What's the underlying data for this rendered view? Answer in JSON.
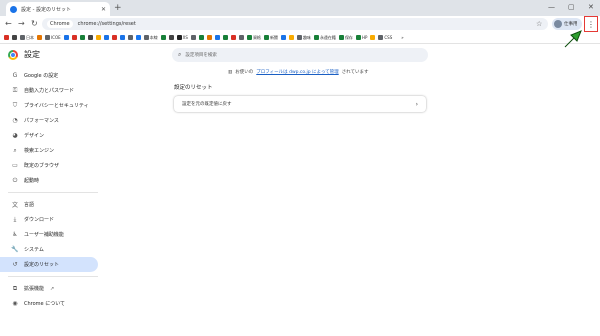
{
  "tab": {
    "title": "設定 - 設定のリセット",
    "close": "✕",
    "new_tab": "+"
  },
  "window_controls": {
    "minimize": "—",
    "restore": "▢",
    "close": "✕"
  },
  "toolbar": {
    "back": "←",
    "forward": "→",
    "reload": "↻",
    "site_chip": "Chrome",
    "url": "chrome://settings/reset",
    "bookmark_star": "☆",
    "profile_label": "仕事用",
    "menu": "⋮"
  },
  "bookmarks": [
    {
      "label": "",
      "color": "#d93025"
    },
    {
      "label": "",
      "color": "#444444"
    },
    {
      "label": "日本",
      "color": "#5f6368"
    },
    {
      "label": "",
      "color": "#e37400"
    },
    {
      "label": "ICOE",
      "color": "#5f6368"
    },
    {
      "label": "",
      "color": "#1a73e8"
    },
    {
      "label": "",
      "color": "#d93025"
    },
    {
      "label": "",
      "color": "#188038"
    },
    {
      "label": "",
      "color": "#444444"
    },
    {
      "label": "",
      "color": "#f9ab00"
    },
    {
      "label": "",
      "color": "#1a73e8"
    },
    {
      "label": "",
      "color": "#d93025"
    },
    {
      "label": "",
      "color": "#1a73e8"
    },
    {
      "label": "",
      "color": "#5f6368"
    },
    {
      "label": "",
      "color": "#1877f2"
    },
    {
      "label": "本線",
      "color": "#5f6368"
    },
    {
      "label": "",
      "color": "#188038"
    },
    {
      "label": "",
      "color": "#444444"
    },
    {
      "label": "XS",
      "color": "#222222"
    },
    {
      "label": "",
      "color": "#5f6368"
    },
    {
      "label": "",
      "color": "#188038"
    },
    {
      "label": "",
      "color": "#e37400"
    },
    {
      "label": "",
      "color": "#1a73e8"
    },
    {
      "label": "",
      "color": "#188038"
    },
    {
      "label": "",
      "color": "#d93025"
    },
    {
      "label": "",
      "color": "#5f6368"
    },
    {
      "label": "資格",
      "color": "#188038"
    },
    {
      "label": "新聞",
      "color": "#188038"
    },
    {
      "label": "",
      "color": "#1a73e8"
    },
    {
      "label": "",
      "color": "#f9ab00"
    },
    {
      "label": "趣味",
      "color": "#5f6368"
    },
    {
      "label": "永遠在籍",
      "color": "#188038"
    },
    {
      "label": "保存",
      "color": "#188038"
    },
    {
      "label": "HP",
      "color": "#188038"
    },
    {
      "label": "",
      "color": "#f9ab00"
    },
    {
      "label": "CSS",
      "color": "#5f6368"
    },
    {
      "label": "»",
      "color": "#ffffff"
    }
  ],
  "header": {
    "title": "設定",
    "search_placeholder": "設定項目を検索"
  },
  "sidebar": {
    "items": [
      {
        "icon": "G",
        "label": "Google の設定"
      },
      {
        "icon": "⚿",
        "label": "自動入力とパスワード"
      },
      {
        "icon": "⛉",
        "label": "プライバシーとセキュリティ"
      },
      {
        "icon": "◔",
        "label": "パフォーマンス"
      },
      {
        "icon": "◕",
        "label": "デザイン"
      },
      {
        "icon": "⌕",
        "label": "検索エンジン"
      },
      {
        "icon": "▭",
        "label": "既定のブラウザ"
      },
      {
        "icon": "⏻",
        "label": "起動時"
      },
      {
        "icon": "文",
        "label": "言語"
      },
      {
        "icon": "⤓",
        "label": "ダウンロード"
      },
      {
        "icon": "♿",
        "label": "ユーザー補助機能"
      },
      {
        "icon": "🔧",
        "label": "システム"
      },
      {
        "icon": "↺",
        "label": "設定のリセット"
      },
      {
        "icon": "⧉",
        "label": "拡張機能"
      },
      {
        "icon": "◉",
        "label": "Chrome について"
      }
    ],
    "external_link_icon": "↗"
  },
  "main": {
    "managed_prefix": "お使いの",
    "managed_link": "プロフィールは dwp.co.jp によって管理",
    "managed_suffix": "されています",
    "section_title": "設定のリセット",
    "reset_row_label": "設定を元の既定値に戻す",
    "chevron": "›"
  },
  "colors": {
    "accent": "#1a73e8",
    "active_bg": "#d3e3fd",
    "arrow": "#2e9e2e",
    "highlight": "#e53935"
  }
}
